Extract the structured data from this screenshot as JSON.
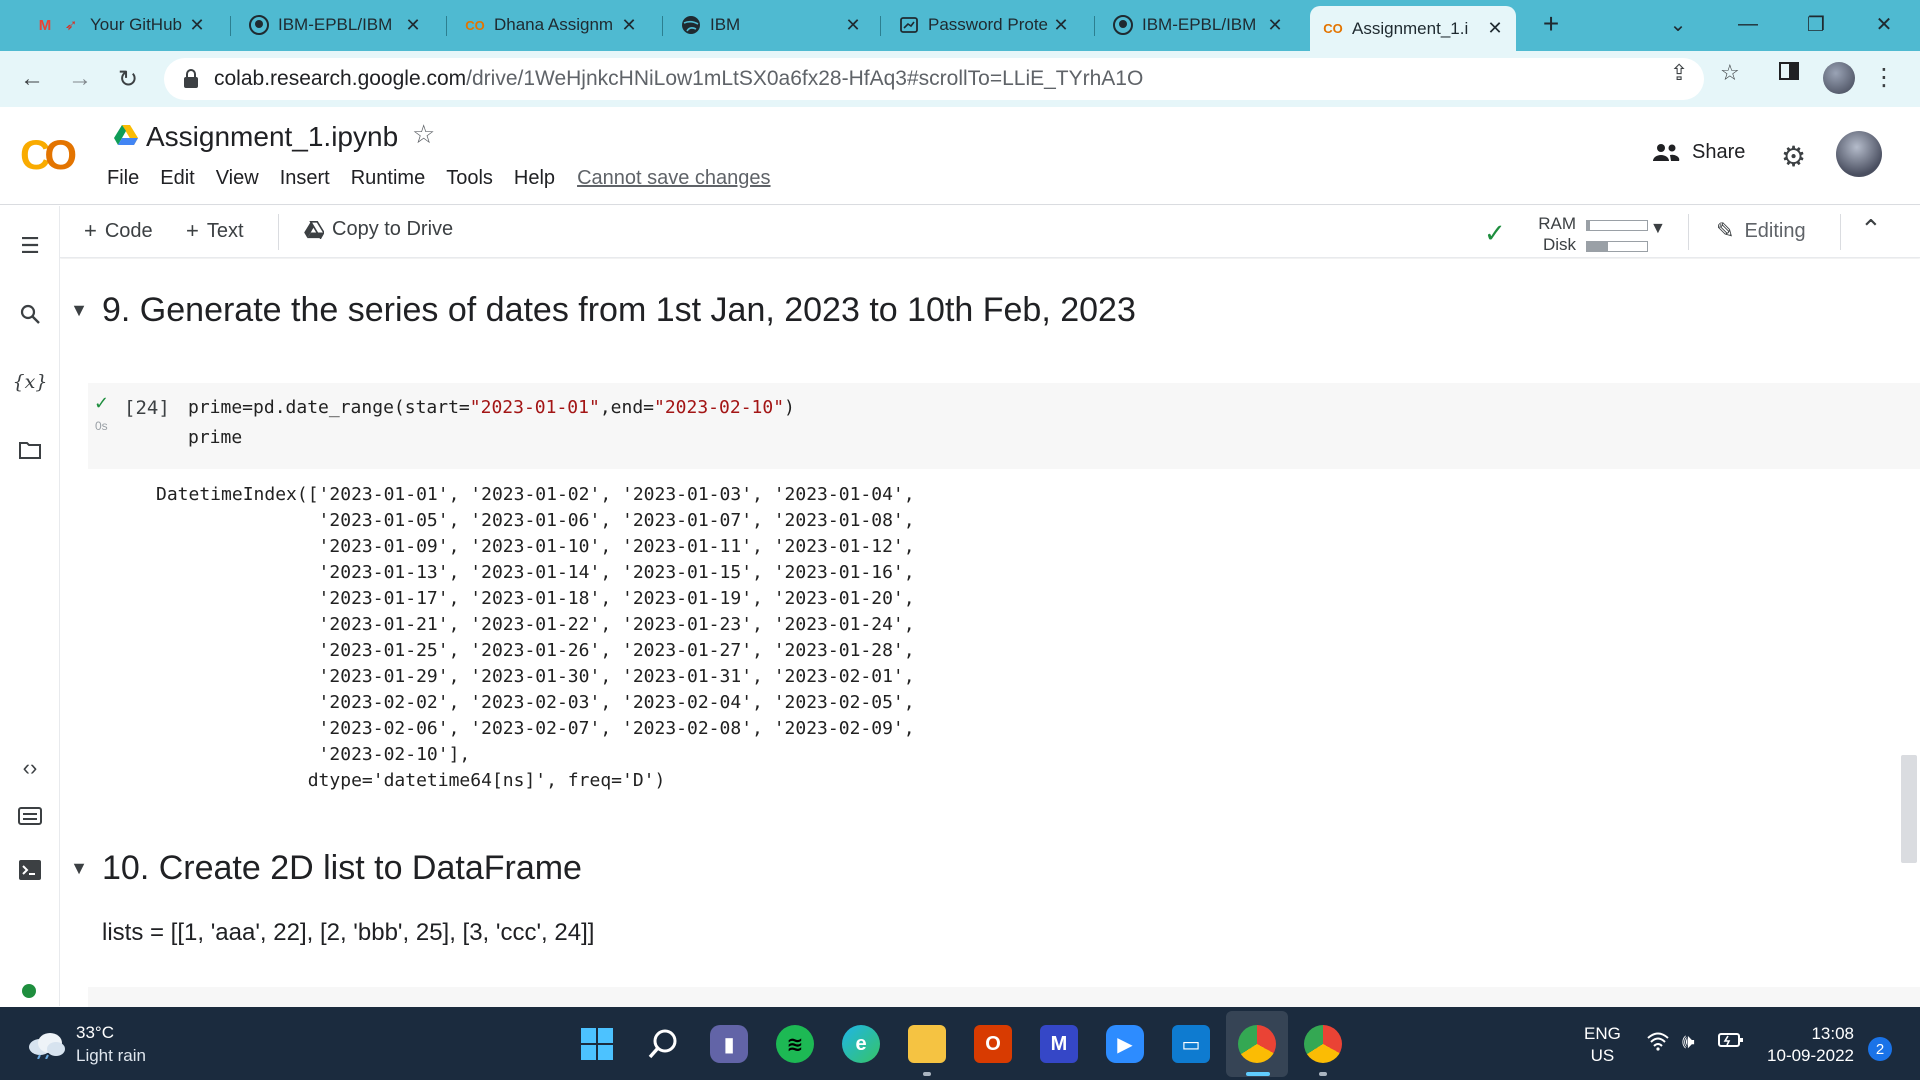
{
  "browser": {
    "tabs": [
      {
        "title": "Your GitHub",
        "icon": "gmail-icon"
      },
      {
        "title": "IBM-EPBL/IBM",
        "icon": "github-icon"
      },
      {
        "title": "Dhana Assignm",
        "icon": "colab-icon"
      },
      {
        "title": "IBM",
        "icon": "globe-icon"
      },
      {
        "title": "Password Prote",
        "icon": "document-icon"
      },
      {
        "title": "IBM-EPBL/IBM",
        "icon": "github-icon"
      },
      {
        "title": "Assignment_1.i",
        "icon": "colab-icon"
      }
    ],
    "url_host": "colab.research.google.com",
    "url_path": "/drive/1WeHjnkcHNiLow1mLtSX0a6fx28-HfAq3#scrollTo=LLiE_TYrhA1O",
    "accent_color": "#4fbad1"
  },
  "colab": {
    "notebook_title": "Assignment_1.ipynb",
    "menu": [
      "File",
      "Edit",
      "View",
      "Insert",
      "Runtime",
      "Tools",
      "Help"
    ],
    "cannot_save": "Cannot save changes",
    "share_label": "Share",
    "toolbar": {
      "code_label": "Code",
      "text_label": "Text",
      "copy_to_drive_label": "Copy to Drive",
      "ram_label": "RAM",
      "disk_label": "Disk",
      "ram_fill": 0.05,
      "disk_fill": 0.35,
      "editing_label": "Editing"
    }
  },
  "notebook": {
    "section9_heading": "9. Generate the series of dates from 1st Jan, 2023 to 10th Feb, 2023",
    "cell": {
      "exec_count": "[24]",
      "run_time": "0s",
      "line1_prefix": "prime=pd.date_range(start=",
      "line1_str1": "\"2023-01-01\"",
      "line1_mid": ",end=",
      "line1_str2": "\"2023-02-10\"",
      "line1_suffix": ")",
      "line2": "prime"
    },
    "output_lines": [
      "DatetimeIndex(['2023-01-01', '2023-01-02', '2023-01-03', '2023-01-04',",
      "               '2023-01-05', '2023-01-06', '2023-01-07', '2023-01-08',",
      "               '2023-01-09', '2023-01-10', '2023-01-11', '2023-01-12',",
      "               '2023-01-13', '2023-01-14', '2023-01-15', '2023-01-16',",
      "               '2023-01-17', '2023-01-18', '2023-01-19', '2023-01-20',",
      "               '2023-01-21', '2023-01-22', '2023-01-23', '2023-01-24',",
      "               '2023-01-25', '2023-01-26', '2023-01-27', '2023-01-28',",
      "               '2023-01-29', '2023-01-30', '2023-01-31', '2023-02-01',",
      "               '2023-02-02', '2023-02-03', '2023-02-04', '2023-02-05',",
      "               '2023-02-06', '2023-02-07', '2023-02-08', '2023-02-09',",
      "               '2023-02-10'],",
      "              dtype='datetime64[ns]', freq='D')"
    ],
    "section10_heading": "10. Create 2D list to DataFrame",
    "section10_text": "lists = [[1, 'aaa', 22], [2, 'bbb', 25], [3, 'ccc', 24]]"
  },
  "taskbar": {
    "temperature": "33°C",
    "weather": "Light rain",
    "lang_top": "ENG",
    "lang_bottom": "US",
    "time": "13:08",
    "date": "10-09-2022",
    "notifications": "2"
  }
}
